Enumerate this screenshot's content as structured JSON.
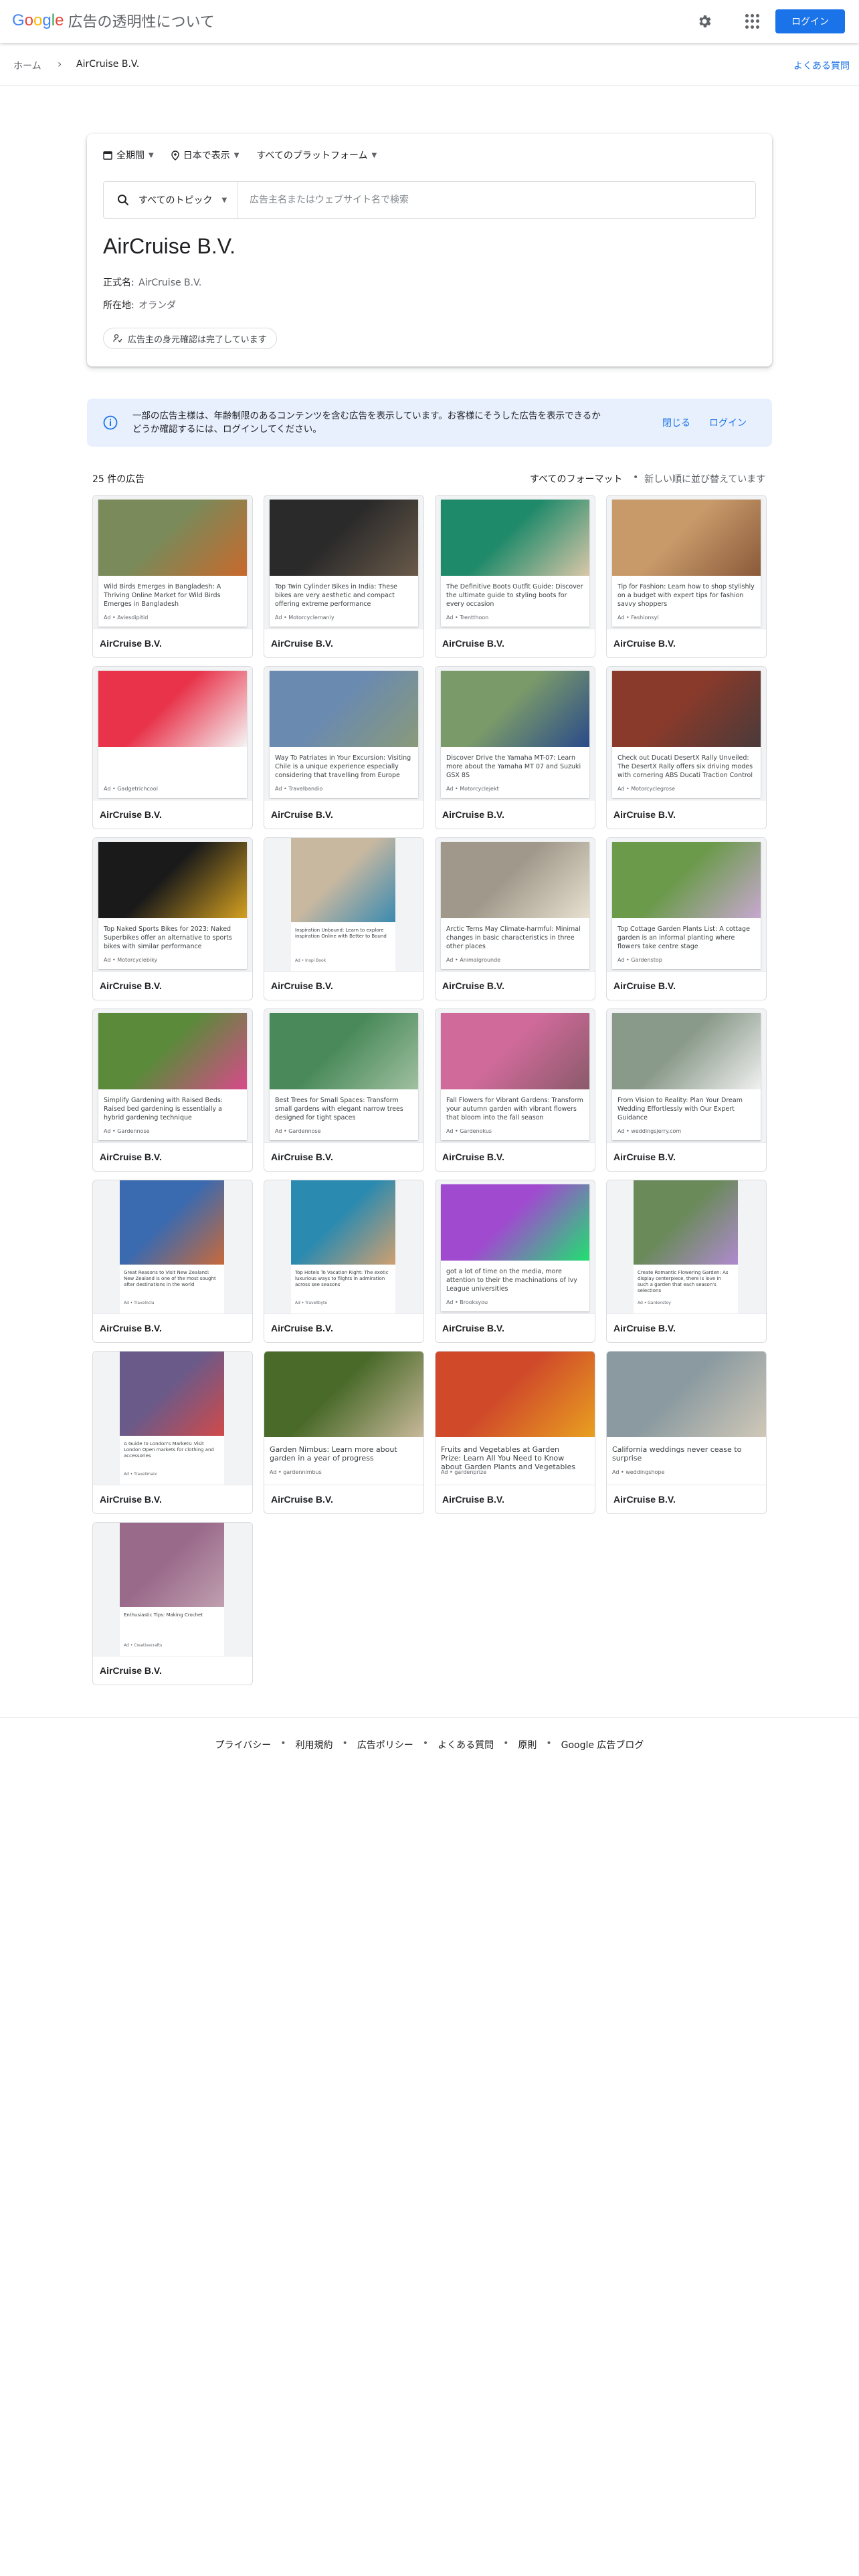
{
  "header": {
    "logo_letters": [
      "G",
      "o",
      "o",
      "g",
      "l",
      "e"
    ],
    "logo_colors": [
      "#4285F4",
      "#EA4335",
      "#FBBC05",
      "#4285F4",
      "#34A853",
      "#EA4335"
    ],
    "title": "広告の透明性について",
    "login_label": "ログイン"
  },
  "breadcrumb": {
    "home": "ホーム",
    "separator": "›",
    "current": "AirCruise B.V.",
    "faq": "よくある質問"
  },
  "filters": {
    "period": "全期間",
    "region": "日本で表示",
    "platform": "すべてのプラットフォーム",
    "topic": "すべてのトピック",
    "search_placeholder": "広告主名またはウェブサイト名で検索"
  },
  "advertiser": {
    "name": "AirCruise B.V.",
    "legal_name_label": "正式名:",
    "legal_name": "AirCruise B.V.",
    "location_label": "所在地:",
    "location": "オランダ",
    "verification": "広告主の身元確認は完了しています"
  },
  "banner": {
    "message": "一部の広告主様は、年齢制限のあるコンテンツを含む広告を表示しています。お客様にそうした広告を表示できるかどうか確認するには、ログインしてください。",
    "close": "閉じる",
    "login": "ログイン"
  },
  "list": {
    "count": "25 件の広告",
    "format": "すべてのフォーマット",
    "dot": "•",
    "sort": "新しい順に並び替えています"
  },
  "ads": [
    {
      "advertiser": "AirCruise B.V.",
      "text": "Wild Birds Emerges in Bangladesh: A Thriving Online Market for Wild Birds Emerges in Bangladesh",
      "source": "Ad • Aviesdipitid",
      "style": "card",
      "colors": [
        "#7a8a5a",
        "#c8692c"
      ]
    },
    {
      "advertiser": "AirCruise B.V.",
      "text": "Top Twin Cylinder Bikes in India: These bikes are very aesthetic and compact offering extreme performance",
      "source": "Ad • Motorcyclemaniy",
      "style": "card",
      "colors": [
        "#2a2a2a",
        "#6a5a4a"
      ]
    },
    {
      "advertiser": "AirCruise B.V.",
      "text": "The Definitive Boots Outfit Guide: Discover the ultimate guide to styling boots for every occasion",
      "source": "Ad • Trentthoon",
      "style": "card",
      "colors": [
        "#1f8a6a",
        "#d9c7a8"
      ]
    },
    {
      "advertiser": "AirCruise B.V.",
      "text": "Tip for Fashion: Learn how to shop stylishly on a budget with expert tips for fashion savvy shoppers",
      "source": "Ad • Fashionsyl",
      "style": "card",
      "colors": [
        "#c89a6a",
        "#8a5a3a"
      ]
    },
    {
      "advertiser": "AirCruise B.V.",
      "text": "",
      "source": "Ad • Gadgetrichcool",
      "style": "card",
      "colors": [
        "#e8334a",
        "#f5f5f5"
      ]
    },
    {
      "advertiser": "AirCruise B.V.",
      "text": "Way To Patriates in Your Excursion: Visiting Chile is a unique experience especially considering that travelling from Europe",
      "source": "Ad • Travelbandio",
      "style": "card",
      "colors": [
        "#6a8ab0",
        "#8a9a7a"
      ]
    },
    {
      "advertiser": "AirCruise B.V.",
      "text": "Discover Drive the Yamaha MT-07: Learn more about the Yamaha MT 07 and Suzuki GSX 8S",
      "source": "Ad • Motorcyclejekt",
      "style": "card",
      "colors": [
        "#7a9a6a",
        "#2a4a8a"
      ]
    },
    {
      "advertiser": "AirCruise B.V.",
      "text": "Check out Ducati DesertX Rally Unveiled: The DesertX Rally offers six driving modes with cornering ABS Ducati Traction Control",
      "source": "Ad • Motorcyclegrose",
      "style": "card",
      "colors": [
        "#8a3a2a",
        "#4a3a3a"
      ]
    },
    {
      "advertiser": "AirCruise B.V.",
      "text": "Top Naked Sports Bikes for 2023: Naked Superbikes offer an alternative to sports bikes with similar performance",
      "source": "Ad • Motorcyclebiky",
      "style": "card",
      "colors": [
        "#1a1a1a",
        "#d4a020"
      ]
    },
    {
      "advertiser": "AirCruise B.V.",
      "text": "Inspiration Unbound: Learn to explore inspiration Online with Better to Bound",
      "source": "Ad • Inspi Book",
      "style": "small",
      "colors": [
        "#c8b8a0",
        "#3a8ab0"
      ]
    },
    {
      "advertiser": "AirCruise B.V.",
      "text": "Arctic Terns May Climate-harmful: Minimal changes in basic characteristics in three other places",
      "source": "Ad • Animalgrounde",
      "style": "card",
      "colors": [
        "#a0988a",
        "#e8e0d0"
      ]
    },
    {
      "advertiser": "AirCruise B.V.",
      "text": "Top Cottage Garden Plants List: A cottage garden is an informal planting where flowers take centre stage",
      "source": "Ad • Gardenstop",
      "style": "card",
      "colors": [
        "#6a9a4a",
        "#c8a8d0"
      ]
    },
    {
      "advertiser": "AirCruise B.V.",
      "text": "Simplify Gardening with Raised Beds: Raised bed gardening is essentially a hybrid gardening technique",
      "source": "Ad • Gardennose",
      "style": "card",
      "colors": [
        "#5a8a3a",
        "#d84a8a"
      ]
    },
    {
      "advertiser": "AirCruise B.V.",
      "text": "Best Trees for Small Spaces: Transform small gardens with elegant narrow trees designed for tight spaces",
      "source": "Ad • Gardennose",
      "style": "card",
      "colors": [
        "#4a8a5a",
        "#a0c0a0"
      ]
    },
    {
      "advertiser": "AirCruise B.V.",
      "text": "Fall Flowers for Vibrant Gardens: Transform your autumn garden with vibrant flowers that bloom into the fall season",
      "source": "Ad • Gardenokus",
      "style": "card",
      "colors": [
        "#d06a9a",
        "#8a5a6a"
      ]
    },
    {
      "advertiser": "AirCruise B.V.",
      "text": "From Vision to Reality: Plan Your Dream Wedding Effortlessly with Our Expert Guidance",
      "source": "Ad • weddingsjerry.com",
      "style": "card",
      "colors": [
        "#8a9a8a",
        "#f0f0f0"
      ]
    },
    {
      "advertiser": "AirCruise B.V.",
      "text": "Great Reasons to Visit New Zealand: New Zealand is one of the most sought after destinations in the world",
      "source": "Ad • Travelncla",
      "style": "small",
      "colors": [
        "#3a6ab0",
        "#c86a3a"
      ]
    },
    {
      "advertiser": "AirCruise B.V.",
      "text": "Top Hotels To Vacation Right: The exotic luxurious ways to flights in admiration across see seasons",
      "source": "Ad • Travellbyte",
      "style": "small",
      "colors": [
        "#2a8ab0",
        "#d0a070"
      ]
    },
    {
      "advertiser": "AirCruise B.V.",
      "text": "got a lot of time on the media, more attention to their the machinations of Ivy League universities",
      "source": "Ad • Brooksyou",
      "style": "card",
      "colors": [
        "#a04ad0",
        "#20e070"
      ]
    },
    {
      "advertiser": "AirCruise B.V.",
      "text": "Create Romantic Flowering Garden: As display centerpiece, there is love in such a garden that each season's selections",
      "source": "Ad • Gardenstoy",
      "style": "small",
      "colors": [
        "#6a8a5a",
        "#b08ad0"
      ]
    },
    {
      "advertiser": "AirCruise B.V.",
      "text": "A Guide to London's Markets: Visit London Open markets for clothing and accessories",
      "source": "Ad • Travelimaix",
      "style": "small",
      "colors": [
        "#6a5a8a",
        "#d04a4a"
      ]
    },
    {
      "advertiser": "AirCruise B.V.",
      "text": "Garden Nimbus: Learn more about garden in a year of progress",
      "source": "Ad • gardennimbus",
      "style": "wide",
      "colors": [
        "#4a6a2a",
        "#c8b89a"
      ]
    },
    {
      "advertiser": "AirCruise B.V.",
      "text": "Fruits and Vegetables at Garden Prize: Learn All You Need to Know about Garden Plants and Vegetables",
      "source": "Ad • gardenprize",
      "style": "wide",
      "colors": [
        "#d04a2a",
        "#e8a020"
      ]
    },
    {
      "advertiser": "AirCruise B.V.",
      "text": "California weddings never cease to surprise",
      "source": "Ad • weddingshope",
      "style": "wide",
      "colors": [
        "#8a9aa0",
        "#d0c8b8"
      ]
    },
    {
      "advertiser": "AirCruise B.V.",
      "text": "Enthusiastic Tips: Making Crochet",
      "source": "Ad • Creativecrafts",
      "style": "small",
      "colors": [
        "#9a6a8a",
        "#c0a0b0"
      ]
    }
  ],
  "footer": {
    "links": [
      "プライバシー",
      "利用規約",
      "広告ポリシー",
      "よくある質問",
      "原則",
      "Google 広告ブログ"
    ],
    "separator": "•"
  },
  "colors": {
    "accent": "#1a73e8",
    "banner_bg": "#e8f0fe",
    "border": "#dadce0"
  }
}
